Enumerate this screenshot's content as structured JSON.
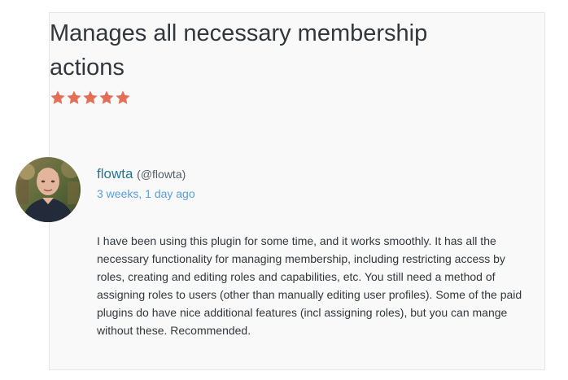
{
  "review": {
    "title": "Manages all necessary membership actions",
    "rating": 5,
    "rating_max": 5,
    "star_color": "#e26f56",
    "author_name": "flowta",
    "author_handle": "(@flowta)",
    "date": "3 weeks, 1 day ago",
    "body": "I have been using this plugin for some time, and it works smoothly. It has all the necessary functionality for managing membership, including restricting access by roles, creating and editing roles and capabilities, etc. You still need a method of assigning roles to users (other than manually editing user profiles). Some of the paid plugins do have nice additional features (incl assigning roles), but you can mange without these. Recommended."
  },
  "icons": {
    "star": "star-filled-icon",
    "avatar": "user-photo"
  }
}
